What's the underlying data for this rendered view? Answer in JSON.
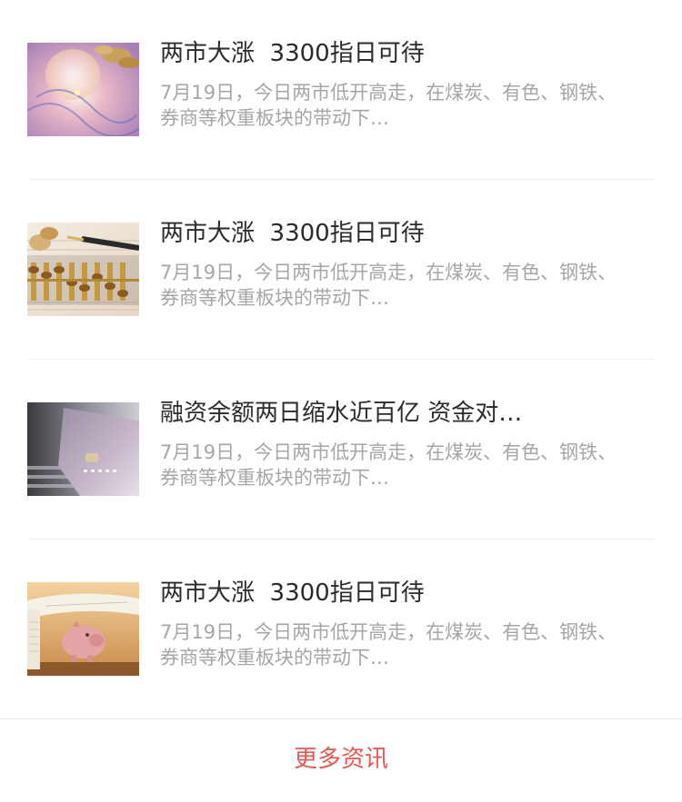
{
  "news": [
    {
      "image": "coins-globe-photo",
      "title": "两市大涨  3300指日可待",
      "summary_line1": "7月19日，今日两市低开高走，在煤炭、有色、钢铁、",
      "summary_line2": "券商等权重板块的带动下…"
    },
    {
      "image": "abacus-pen-photo",
      "title": "两市大涨  3300指日可待",
      "summary_line1": "7月19日，今日两市低开高走，在煤炭、有色、钢铁、",
      "summary_line2": "券商等权重板块的带动下…"
    },
    {
      "image": "credit-card-keyboard-photo",
      "title": "融资余额两日缩水近百亿 资金对…",
      "summary_line1": "7月19日，今日两市低开高走，在煤炭、有色、钢铁、",
      "summary_line2": "券商等权重板块的带动下…"
    },
    {
      "image": "piggy-bank-newspaper-photo",
      "title": "两市大涨  3300指日可待",
      "summary_line1": "7月19日，今日两市低开高走，在煤炭、有色、钢铁、",
      "summary_line2": "券商等权重板块的带动下…"
    }
  ],
  "more_label": "更多资讯",
  "colors": {
    "title": "#2b2b2b",
    "summary": "#a6a6a6",
    "accent": "#e8584f",
    "divider": "#eeeeee"
  }
}
